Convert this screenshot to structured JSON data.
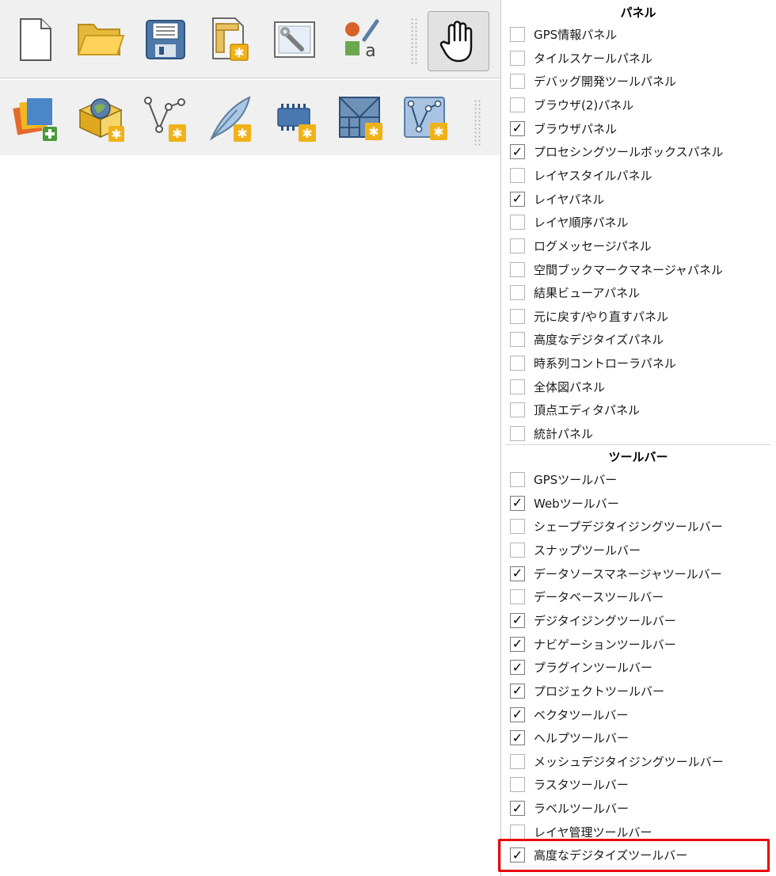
{
  "toolbar_top": {
    "buttons": [
      {
        "name": "new-project-icon"
      },
      {
        "name": "open-project-icon"
      },
      {
        "name": "save-project-icon"
      },
      {
        "name": "new-print-layout-icon"
      },
      {
        "name": "layout-manager-icon"
      },
      {
        "name": "style-manager-icon"
      },
      {
        "name": "pan-map-icon",
        "active": true
      }
    ]
  },
  "toolbar_bottom": {
    "buttons": [
      {
        "name": "data-source-manager-icon"
      },
      {
        "name": "new-geopackage-layer-icon"
      },
      {
        "name": "new-shapefile-layer-icon"
      },
      {
        "name": "new-temporary-scratch-layer-icon"
      },
      {
        "name": "new-virtual-layer-icon"
      },
      {
        "name": "new-mesh-layer-icon"
      },
      {
        "name": "new-gps-layer-icon"
      }
    ]
  },
  "menu": {
    "panels_header": "パネル",
    "panels": [
      {
        "label": "GPS情報パネル",
        "checked": false
      },
      {
        "label": "タイルスケールパネル",
        "checked": false
      },
      {
        "label": "デバッグ開発ツールパネル",
        "checked": false
      },
      {
        "label": "ブラウザ(2)パネル",
        "checked": false
      },
      {
        "label": "ブラウザパネル",
        "checked": true
      },
      {
        "label": "プロセシングツールボックスパネル",
        "checked": true
      },
      {
        "label": "レイヤスタイルパネル",
        "checked": false
      },
      {
        "label": "レイヤパネル",
        "checked": true
      },
      {
        "label": "レイヤ順序パネル",
        "checked": false
      },
      {
        "label": "ログメッセージパネル",
        "checked": false
      },
      {
        "label": "空間ブックマークマネージャパネル",
        "checked": false
      },
      {
        "label": "結果ビューアパネル",
        "checked": false
      },
      {
        "label": "元に戻す/やり直すパネル",
        "checked": false
      },
      {
        "label": "高度なデジタイズパネル",
        "checked": false
      },
      {
        "label": "時系列コントローラパネル",
        "checked": false
      },
      {
        "label": "全体図パネル",
        "checked": false
      },
      {
        "label": "頂点エディタパネル",
        "checked": false
      },
      {
        "label": "統計パネル",
        "checked": false
      }
    ],
    "toolbars_header": "ツールバー",
    "toolbars": [
      {
        "label": "GPSツールバー",
        "checked": false
      },
      {
        "label": "Webツールバー",
        "checked": true
      },
      {
        "label": "シェープデジタイジングツールバー",
        "checked": false
      },
      {
        "label": "スナップツールバー",
        "checked": false
      },
      {
        "label": "データソースマネージャツールバー",
        "checked": true
      },
      {
        "label": "データベースツールバー",
        "checked": false
      },
      {
        "label": "デジタイジングツールバー",
        "checked": true
      },
      {
        "label": "ナビゲーションツールバー",
        "checked": true
      },
      {
        "label": "プラグインツールバー",
        "checked": true
      },
      {
        "label": "プロジェクトツールバー",
        "checked": true
      },
      {
        "label": "ベクタツールバー",
        "checked": true
      },
      {
        "label": "ヘルプツールバー",
        "checked": true
      },
      {
        "label": "メッシュデジタイジングツールバー",
        "checked": false
      },
      {
        "label": "ラスタツールバー",
        "checked": false
      },
      {
        "label": "ラベルツールバー",
        "checked": true
      },
      {
        "label": "レイヤ管理ツールバー",
        "checked": false
      },
      {
        "label": "高度なデジタイズツールバー",
        "checked": true
      }
    ],
    "check_mark": "✓",
    "highlight_color": "#e8000a"
  }
}
